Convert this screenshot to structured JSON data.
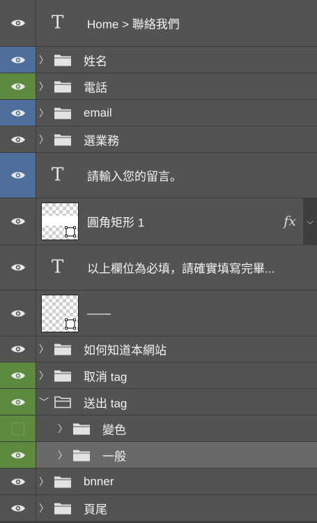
{
  "layers": [
    {
      "label": "Home > 聯絡我們",
      "kind": "text"
    },
    {
      "label": "姓名",
      "kind": "folder"
    },
    {
      "label": "電話",
      "kind": "folder"
    },
    {
      "label": "email",
      "kind": "folder"
    },
    {
      "label": "選業務",
      "kind": "folder"
    },
    {
      "label": "請輸入您的留言。",
      "kind": "text"
    },
    {
      "label": "圓角矩形 1",
      "kind": "shape",
      "fx": "fx"
    },
    {
      "label": "以上欄位為必填，請確實填寫完畢...",
      "kind": "text"
    },
    {
      "label": "——",
      "kind": "shape"
    },
    {
      "label": "如何知道本網站",
      "kind": "folder"
    },
    {
      "label": "取消 tag",
      "kind": "folder"
    },
    {
      "label": "送出 tag",
      "kind": "folder",
      "expanded": true
    },
    {
      "label": "變色",
      "kind": "folder",
      "hidden": true
    },
    {
      "label": "一般",
      "kind": "folder",
      "selected": true
    },
    {
      "label": "bnner",
      "kind": "folder"
    },
    {
      "label": "頁尾",
      "kind": "folder"
    }
  ],
  "colors": {
    "panel": "#535353",
    "eye_blue": "#4e6f9c",
    "eye_green": "#5d8a3f",
    "selected_row": "#696969"
  },
  "icons": {
    "visibility": "eye-icon",
    "folder": "folder-icon",
    "text_layer": "text-layer-icon",
    "shape": "shape-layer-icon"
  }
}
